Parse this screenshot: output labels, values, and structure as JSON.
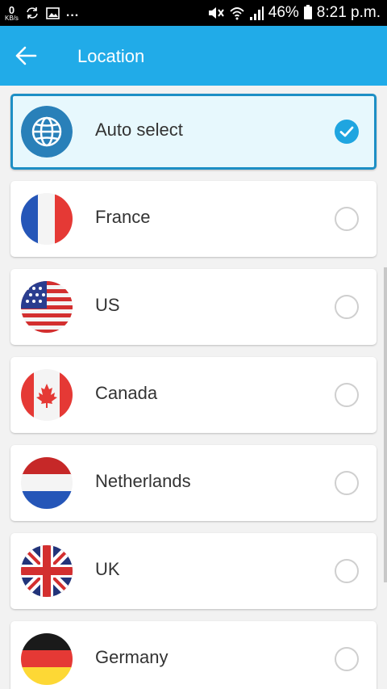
{
  "status_bar": {
    "speed": "0",
    "speed_unit": "KB/s",
    "dots": "...",
    "battery": "46%",
    "time": "8:21 p.m."
  },
  "header": {
    "title": "Location",
    "back_icon": "back-arrow-icon"
  },
  "locations": [
    {
      "label": "Auto select",
      "selected": true,
      "icon": "globe-icon"
    },
    {
      "label": "France",
      "selected": false,
      "icon": "france-flag-icon"
    },
    {
      "label": "US",
      "selected": false,
      "icon": "us-flag-icon"
    },
    {
      "label": "Canada",
      "selected": false,
      "icon": "canada-flag-icon"
    },
    {
      "label": "Netherlands",
      "selected": false,
      "icon": "netherlands-flag-icon"
    },
    {
      "label": "UK",
      "selected": false,
      "icon": "uk-flag-icon"
    },
    {
      "label": "Germany",
      "selected": false,
      "icon": "germany-flag-icon"
    }
  ],
  "colors": {
    "accent": "#21abe8",
    "selected_border": "#1d8fc5",
    "selected_bg": "#e7f8fd",
    "check": "#1fa5e0"
  }
}
